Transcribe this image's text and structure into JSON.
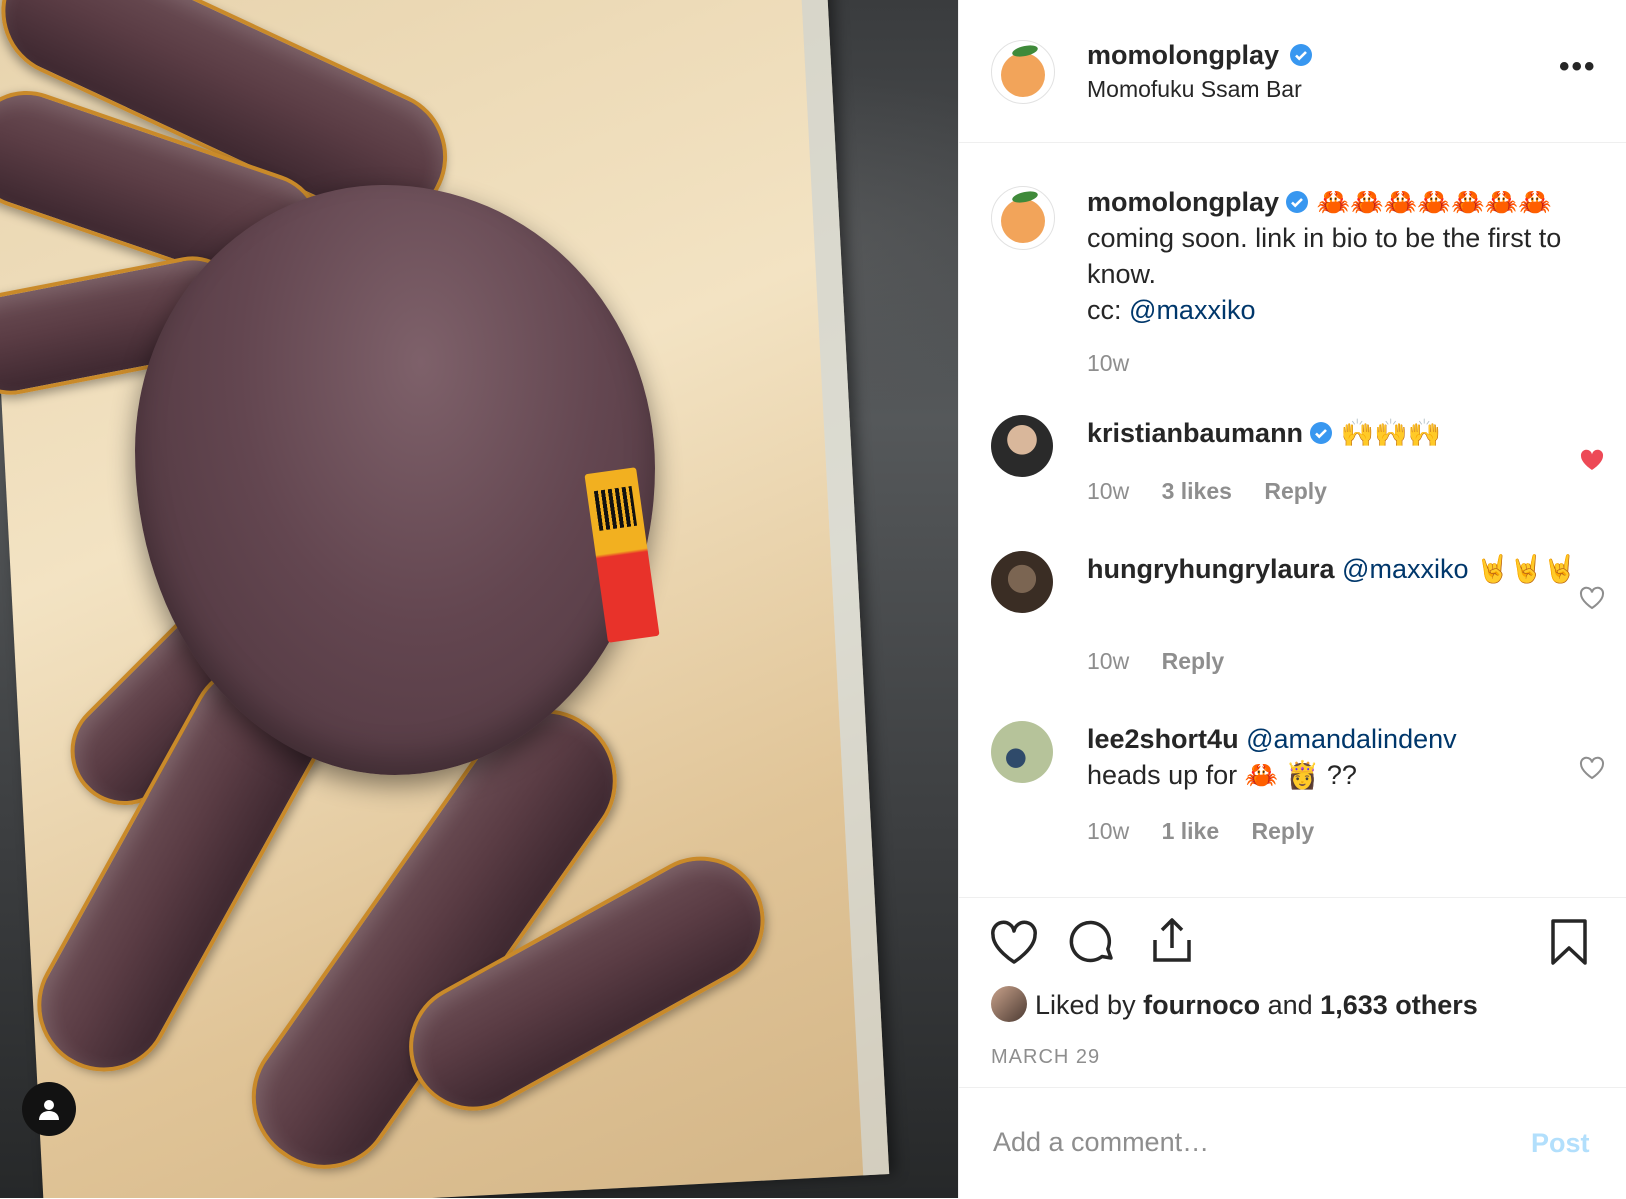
{
  "post": {
    "author": "momolongplay",
    "location": "Momofuku Ssam Bar",
    "more_label": "•••",
    "user_tag_icon": "person-icon",
    "caption": {
      "username": "momolongplay",
      "emoji": "🦀🦀🦀🦀🦀🦀🦀",
      "text": "coming soon. link in bio to be the first to know.",
      "cc_label": "cc:",
      "mention": "@maxxiko",
      "time": "10w"
    },
    "comments": [
      {
        "username": "kristianbaumann",
        "verified": true,
        "text": "🙌🙌🙌",
        "time": "10w",
        "likes": "3 likes",
        "reply": "Reply",
        "liked": true
      },
      {
        "username": "hungryhungrylaura",
        "mention": "@maxxiko",
        "text": "🤘🤘🤘",
        "time": "10w",
        "reply": "Reply",
        "liked": false
      },
      {
        "username": "lee2short4u",
        "mention": "@amandalindenv",
        "text": "heads up for 🦀 👸 ??",
        "time": "10w",
        "likes": "1 like",
        "reply": "Reply",
        "liked": false
      }
    ],
    "liked_by": {
      "prefix": "Liked by",
      "user": "fournoco",
      "joiner": "and",
      "others": "1,633 others"
    },
    "date": "MARCH 29",
    "composer": {
      "placeholder": "Add a comment…",
      "post_label": "Post"
    },
    "icons": [
      "heart-icon",
      "comment-icon",
      "share-icon",
      "bookmark-icon",
      "verified-badge-icon"
    ],
    "colors": {
      "verified": "#3897f0",
      "liked": "#ed4956",
      "link": "#00376b",
      "post_disabled": "#b2dffc"
    }
  }
}
